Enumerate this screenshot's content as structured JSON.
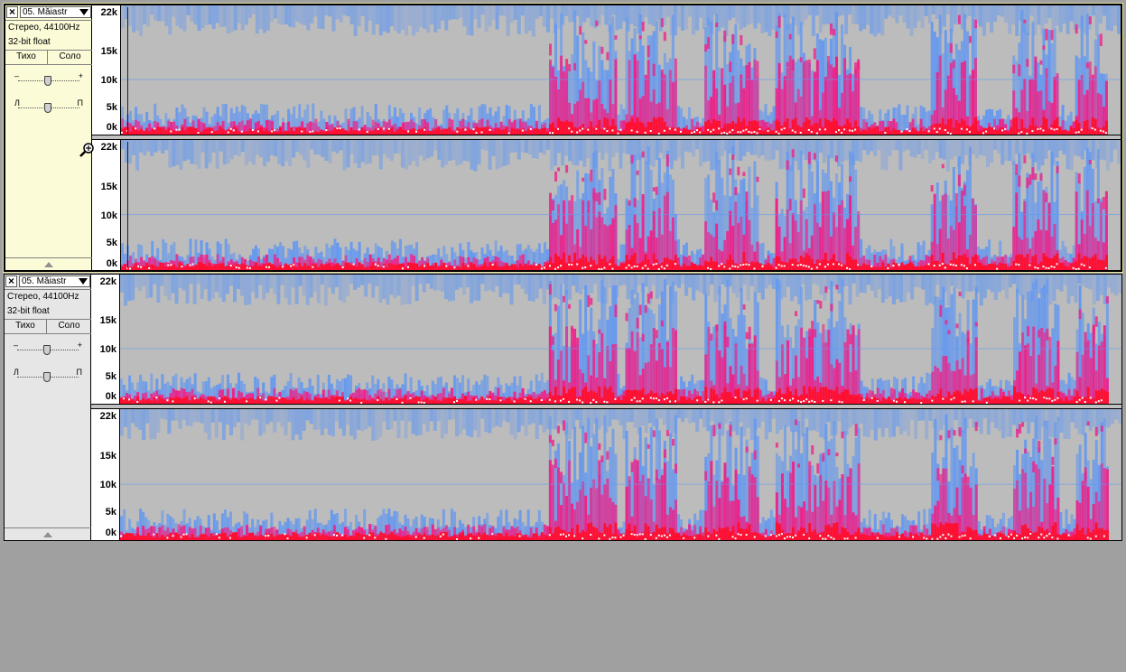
{
  "tracks": [
    {
      "name": "05. Măiastr",
      "format": "Стерео, 44100Hz",
      "bitdepth": "32-bit float",
      "mute_label": "Тихо",
      "solo_label": "Соло",
      "gain_minus": "–",
      "gain_plus": "+",
      "pan_left": "Л",
      "pan_right": "П",
      "selected": true
    },
    {
      "name": "05. Măiastr",
      "format": "Стерео, 44100Hz",
      "bitdepth": "32-bit float",
      "mute_label": "Тихо",
      "solo_label": "Соло",
      "gain_minus": "–",
      "gain_plus": "+",
      "pan_left": "Л",
      "pan_right": "П",
      "selected": false
    }
  ],
  "ruler_labels": [
    "22k",
    "15k",
    "10k",
    "5k",
    "0k"
  ],
  "colors": {
    "background": "#a0a0a0",
    "spectro_bg": "#bcbcbc",
    "spectro_low": "#6699ee",
    "spectro_mid": "#ee2288",
    "spectro_high": "#ff1030",
    "spectro_peak": "#ffffff"
  },
  "icons": {
    "close": "close-icon",
    "dropdown": "chevron-down-icon",
    "collapse": "collapse-up-icon",
    "zoom": "zoom-cursor-icon"
  }
}
